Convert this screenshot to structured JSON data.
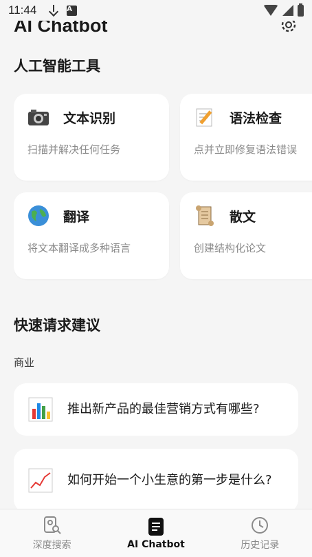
{
  "status_bar": {
    "time": "11:44"
  },
  "header": {
    "title": "AI Chatbot"
  },
  "tools_section": {
    "title": "人工智能工具",
    "cards": [
      {
        "name": "文本识别",
        "desc": "扫描并解决任何任务",
        "icon": "camera-icon"
      },
      {
        "name": "语法检查",
        "desc": "点并立即修复语法错误",
        "icon": "memo-icon"
      },
      {
        "name": "翻译",
        "desc": "将文本翻译成多种语言",
        "icon": "globe-icon"
      },
      {
        "name": "散文",
        "desc": "创建结构化论文",
        "icon": "scroll-icon"
      }
    ]
  },
  "suggestions_section": {
    "title": "快速请求建议",
    "category": "商业",
    "items": [
      {
        "text": "推出新产品的最佳营销方式有哪些?",
        "icon": "bar-chart-icon"
      },
      {
        "text": "如何开始一个小生意的第一步是什么?",
        "icon": "line-chart-icon"
      }
    ]
  },
  "bottom_nav": {
    "items": [
      {
        "label": "深度搜索",
        "icon": "deep-search-icon",
        "active": false
      },
      {
        "label": "AI Chatbot",
        "icon": "chatbot-icon",
        "active": true
      },
      {
        "label": "历史记录",
        "icon": "clock-icon",
        "active": false
      }
    ]
  }
}
